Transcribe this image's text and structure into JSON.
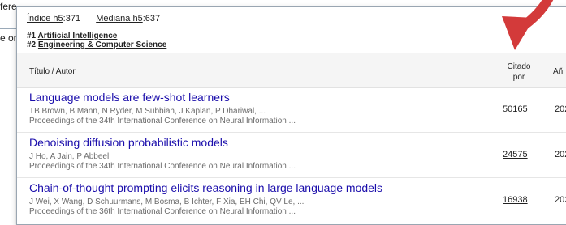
{
  "background": {
    "top_text": "fere",
    "mid_text": "e on",
    "divider_color": "#9aa9b8"
  },
  "metrics": {
    "h5_index_label": "Índice h5",
    "h5_index_value": ":371",
    "h5_median_label": "Mediana h5",
    "h5_median_value": ":637"
  },
  "categories": [
    {
      "rank": "#1",
      "label": "Artificial Intelligence"
    },
    {
      "rank": "#2",
      "label": "Engineering & Computer Science"
    }
  ],
  "table": {
    "col_title": "Título / Autor",
    "col_cited_line1": "Citado",
    "col_cited_line2": "por",
    "col_year": "Añ",
    "rows": [
      {
        "title": "Language models are few-shot learners",
        "authors": "TB Brown, B Mann, N Ryder, M Subbiah, J Kaplan, P Dhariwal, ...",
        "venue": "Proceedings of the 34th International Conference on Neural Information ...",
        "cites": "50165",
        "year": "202"
      },
      {
        "title": "Denoising diffusion probabilistic models",
        "authors": "J Ho, A Jain, P Abbeel",
        "venue": "Proceedings of the 34th International Conference on Neural Information ...",
        "cites": "24575",
        "year": "202"
      },
      {
        "title": "Chain-of-thought prompting elicits reasoning in large language models",
        "authors": "J Wei, X Wang, D Schuurmans, M Bosma, B Ichter, F Xia, EH Chi, QV Le, ...",
        "venue": "Proceedings of the 36th International Conference on Neural Information ...",
        "cites": "16938",
        "year": "202"
      }
    ]
  },
  "annotation": {
    "arrow_color": "#d33a3a"
  },
  "colors": {
    "link_blue": "#1a0dab",
    "meta_gray": "#6b6b6b",
    "header_bg": "#f5f5f5"
  }
}
